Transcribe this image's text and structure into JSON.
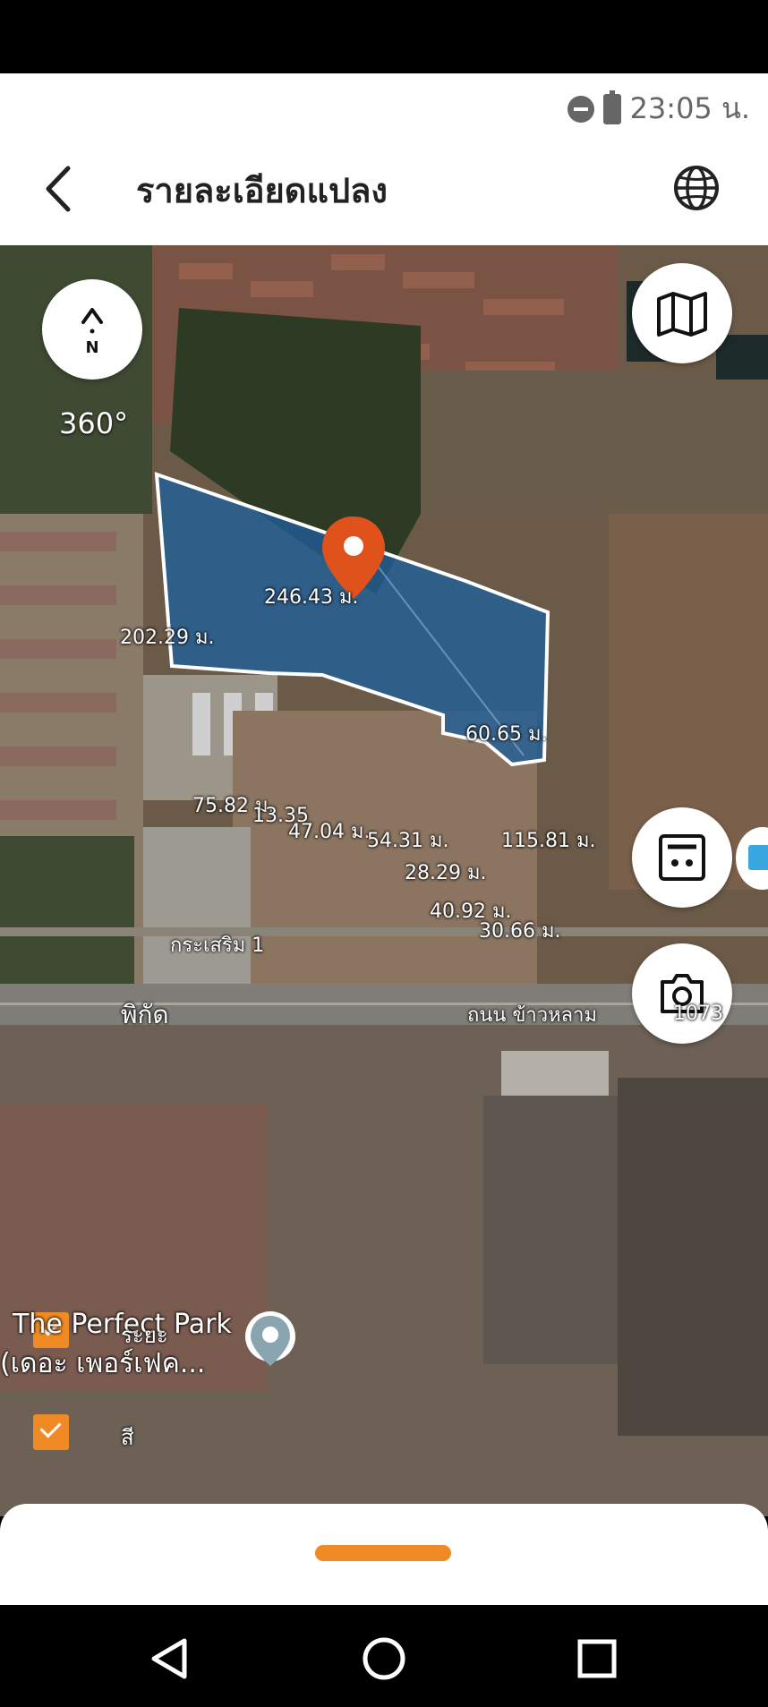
{
  "status": {
    "time": "23:05 น."
  },
  "header": {
    "title": "รายละเอียดแปลง"
  },
  "map": {
    "compass_label": "N",
    "heading": "360°",
    "dimensions": {
      "d1": "246.43 ม.",
      "d2": "202.29 ม.",
      "d3": "60.65 ม.",
      "d4": "75.82 ม.",
      "d5": "13.35",
      "d6": "47.04 ม.",
      "d7": "54.31 ม.",
      "d8": "115.81 ม.",
      "d9": "28.29 ม.",
      "d10": "40.92 ม.",
      "d11": "30.66 ม."
    },
    "roads": {
      "r1": "กระเสริม 1",
      "r2": "พิกัด",
      "r3": "ถนน ข้าวหลาม",
      "r4": "1073"
    },
    "poi": {
      "line1": "The Perfect Park",
      "line2": "(เดอะ เพอร์เฟค...",
      "line3": "ระยะ",
      "line4": "สี"
    }
  },
  "colors": {
    "accent": "#f08a24",
    "parcel": "#1f5f9a",
    "pin": "#e0521c"
  }
}
